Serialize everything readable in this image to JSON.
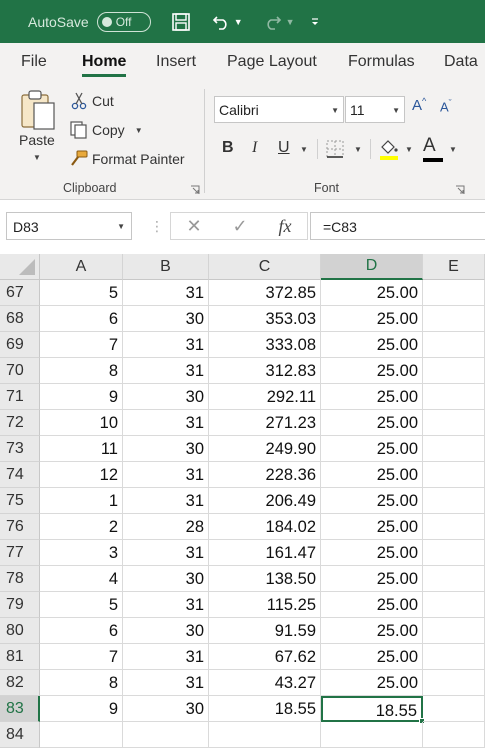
{
  "titlebar": {
    "autosave_label": "AutoSave",
    "autosave_state": "Off",
    "bg_color": "#217346"
  },
  "tabs": [
    "File",
    "Home",
    "Insert",
    "Page Layout",
    "Formulas",
    "Data"
  ],
  "active_tab": "Home",
  "clipboard": {
    "paste": "Paste",
    "cut": "Cut",
    "copy": "Copy",
    "format_painter": "Format Painter",
    "group_label": "Clipboard"
  },
  "font": {
    "name": "Calibri",
    "size": "11",
    "group_label": "Font",
    "bold": "B",
    "italic": "I",
    "underline": "U",
    "color_letter": "A"
  },
  "formula_bar": {
    "name_box": "D83",
    "formula": "=C83"
  },
  "columns": [
    "A",
    "B",
    "C",
    "D",
    "E"
  ],
  "selected_column": "D",
  "selected_row": "83",
  "rows": [
    {
      "num": "67",
      "A": "5",
      "B": "31",
      "C": "372.85",
      "D": "25.00"
    },
    {
      "num": "68",
      "A": "6",
      "B": "30",
      "C": "353.03",
      "D": "25.00"
    },
    {
      "num": "69",
      "A": "7",
      "B": "31",
      "C": "333.08",
      "D": "25.00"
    },
    {
      "num": "70",
      "A": "8",
      "B": "31",
      "C": "312.83",
      "D": "25.00"
    },
    {
      "num": "71",
      "A": "9",
      "B": "30",
      "C": "292.11",
      "D": "25.00"
    },
    {
      "num": "72",
      "A": "10",
      "B": "31",
      "C": "271.23",
      "D": "25.00"
    },
    {
      "num": "73",
      "A": "11",
      "B": "30",
      "C": "249.90",
      "D": "25.00"
    },
    {
      "num": "74",
      "A": "12",
      "B": "31",
      "C": "228.36",
      "D": "25.00"
    },
    {
      "num": "75",
      "A": "1",
      "B": "31",
      "C": "206.49",
      "D": "25.00"
    },
    {
      "num": "76",
      "A": "2",
      "B": "28",
      "C": "184.02",
      "D": "25.00"
    },
    {
      "num": "77",
      "A": "3",
      "B": "31",
      "C": "161.47",
      "D": "25.00"
    },
    {
      "num": "78",
      "A": "4",
      "B": "30",
      "C": "138.50",
      "D": "25.00"
    },
    {
      "num": "79",
      "A": "5",
      "B": "31",
      "C": "115.25",
      "D": "25.00"
    },
    {
      "num": "80",
      "A": "6",
      "B": "30",
      "C": "91.59",
      "D": "25.00"
    },
    {
      "num": "81",
      "A": "7",
      "B": "31",
      "C": "67.62",
      "D": "25.00"
    },
    {
      "num": "82",
      "A": "8",
      "B": "31",
      "C": "43.27",
      "D": "25.00"
    },
    {
      "num": "83",
      "A": "9",
      "B": "30",
      "C": "18.55",
      "D": "18.55"
    },
    {
      "num": "84",
      "A": "",
      "B": "",
      "C": "",
      "D": ""
    }
  ]
}
